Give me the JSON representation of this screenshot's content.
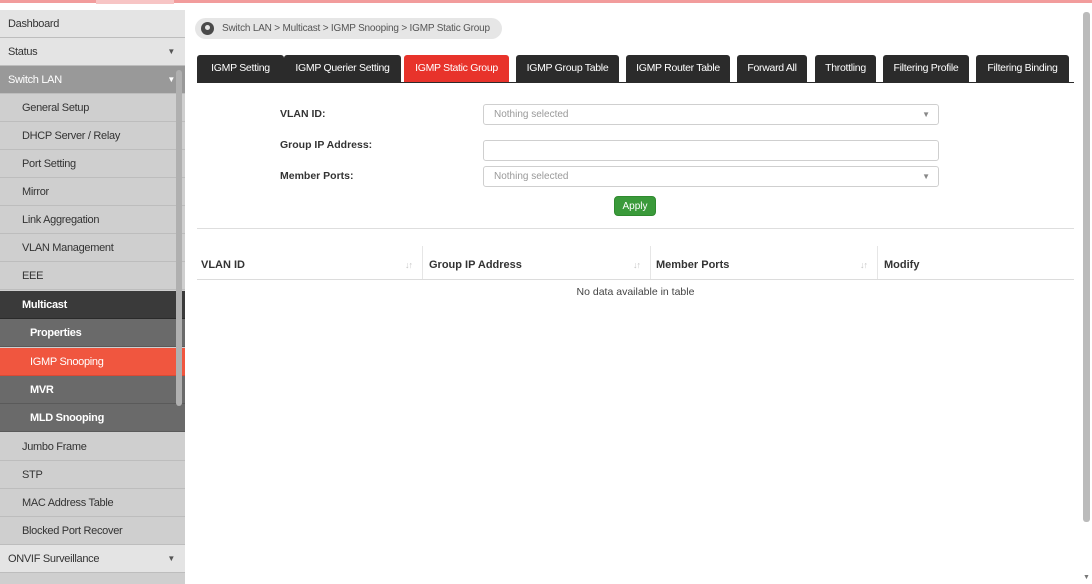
{
  "breadcrumb": {
    "path": "Switch LAN > Multicast > IGMP Snooping  > IGMP Static Group"
  },
  "sidebar": {
    "items": [
      {
        "label": "Dashboard"
      },
      {
        "label": "Status"
      },
      {
        "label": "Switch LAN"
      },
      {
        "label": "General Setup"
      },
      {
        "label": "DHCP Server / Relay"
      },
      {
        "label": "Port Setting"
      },
      {
        "label": "Mirror"
      },
      {
        "label": "Link Aggregation"
      },
      {
        "label": "VLAN Management"
      },
      {
        "label": "EEE"
      },
      {
        "label": "Multicast"
      },
      {
        "label": "Properties"
      },
      {
        "label": "IGMP Snooping"
      },
      {
        "label": "MVR"
      },
      {
        "label": "MLD Snooping"
      },
      {
        "label": "Jumbo Frame"
      },
      {
        "label": "STP"
      },
      {
        "label": "MAC Address Table"
      },
      {
        "label": "Blocked Port Recover"
      },
      {
        "label": "ONVIF Surveillance"
      }
    ],
    "active_item": "IGMP Snooping"
  },
  "tabs": [
    {
      "label": "IGMP Setting"
    },
    {
      "label": "IGMP Querier Setting"
    },
    {
      "label": "IGMP Static Group"
    },
    {
      "label": "IGMP Group Table"
    },
    {
      "label": "IGMP Router Table"
    },
    {
      "label": "Forward All"
    },
    {
      "label": "Throttling"
    },
    {
      "label": "Filtering Profile"
    },
    {
      "label": "Filtering Binding"
    }
  ],
  "active_tab": "IGMP Static Group",
  "form": {
    "vlan_id_label": "VLAN ID:",
    "vlan_id_value": "Nothing selected",
    "group_ip_label": "Group IP Address:",
    "group_ip_value": "",
    "member_ports_label": "Member Ports:",
    "member_ports_value": "Nothing selected",
    "apply_label": "Apply"
  },
  "table": {
    "columns": [
      "VLAN ID",
      "Group IP Address",
      "Member Ports",
      "Modify"
    ],
    "sort_glyph": "↓↑",
    "empty_message": "No data available in table"
  },
  "colors": {
    "active_accent": "#e8332b",
    "sidebar_active": "#f0563f",
    "tab_bg": "#2b2b2b",
    "apply_button": "#3a9a3a"
  },
  "icons": {
    "breadcrumb": "location-pin-icon",
    "dropdown": "caret-down-icon",
    "sort": "sort-icon"
  }
}
